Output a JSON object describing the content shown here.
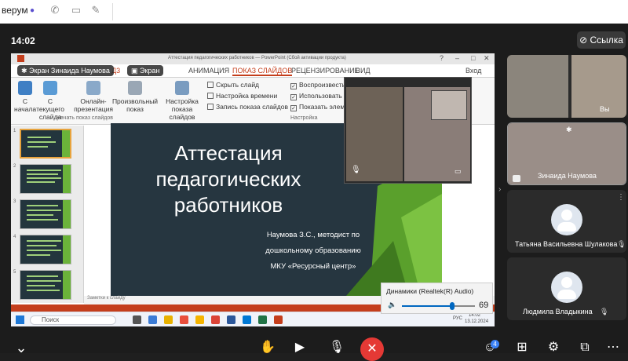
{
  "topbar": {
    "title": "верум"
  },
  "meeting": {
    "clock": "14:02",
    "link_label": "Ссылка",
    "share_label_1": "Экран Зинаида Наумова",
    "share_label_2": "Экран",
    "bottom_controls": [
      "hand-icon",
      "camera-icon",
      "microphone-icon",
      "hangup-icon",
      "participants-icon",
      "layout-icon",
      "settings-icon",
      "share-icon",
      "more-icon"
    ],
    "participants_badge": "4"
  },
  "ppt": {
    "window_title": "Аттестация педагогических работников — PowerPoint (Сбой активации продукта)",
    "login": "Вход",
    "tabs": [
      "АНИМАЦИЯ",
      "ПОКАЗ СЛАЙДОВ",
      "РЕЦЕНЗИРОВАНИЕ",
      "ВИД"
    ],
    "tab_prefix": "Д3",
    "ribbon": {
      "from_start": "С начала",
      "from_current": "С текущего слайда",
      "online": "Онлайн-презентация",
      "custom": "Произвольный показ",
      "setup": "Настройка показа слайдов",
      "hide_slide": "Скрыть слайд",
      "rehearse": "Настройка времени",
      "record": "Запись показа слайдов",
      "play_narr": "Воспроизвести",
      "use_timings": "Использовать",
      "show_controls": "Показать элеме",
      "group_start": "Начать показ слайдов",
      "group_setup": "Настройка"
    },
    "slide": {
      "title_line1": "Аттестация",
      "title_line2": "педагогических",
      "title_line3": "работников",
      "sub_line1": "Наумова З.С., методист по",
      "sub_line2": "дошкольному образованию",
      "sub_line3": "МКУ «Ресурсный центр»"
    },
    "thumb_numbers": [
      "1",
      "2",
      "3",
      "4",
      "5"
    ],
    "notes_label": "Заметки к слайду",
    "taskbar_search": "Поиск",
    "tray_time": "14:02",
    "tray_date": "13.12.2024",
    "tray_lang": "РУС"
  },
  "volume": {
    "device": "Динамики (Realtek(R) Audio)",
    "level": "69"
  },
  "tiles": [
    {
      "name": "Вы"
    },
    {
      "name": "Зинаида Наумова"
    },
    {
      "name": "Татьяна Васильевна Шулакова"
    },
    {
      "name": "Людмила Владыкина"
    }
  ]
}
